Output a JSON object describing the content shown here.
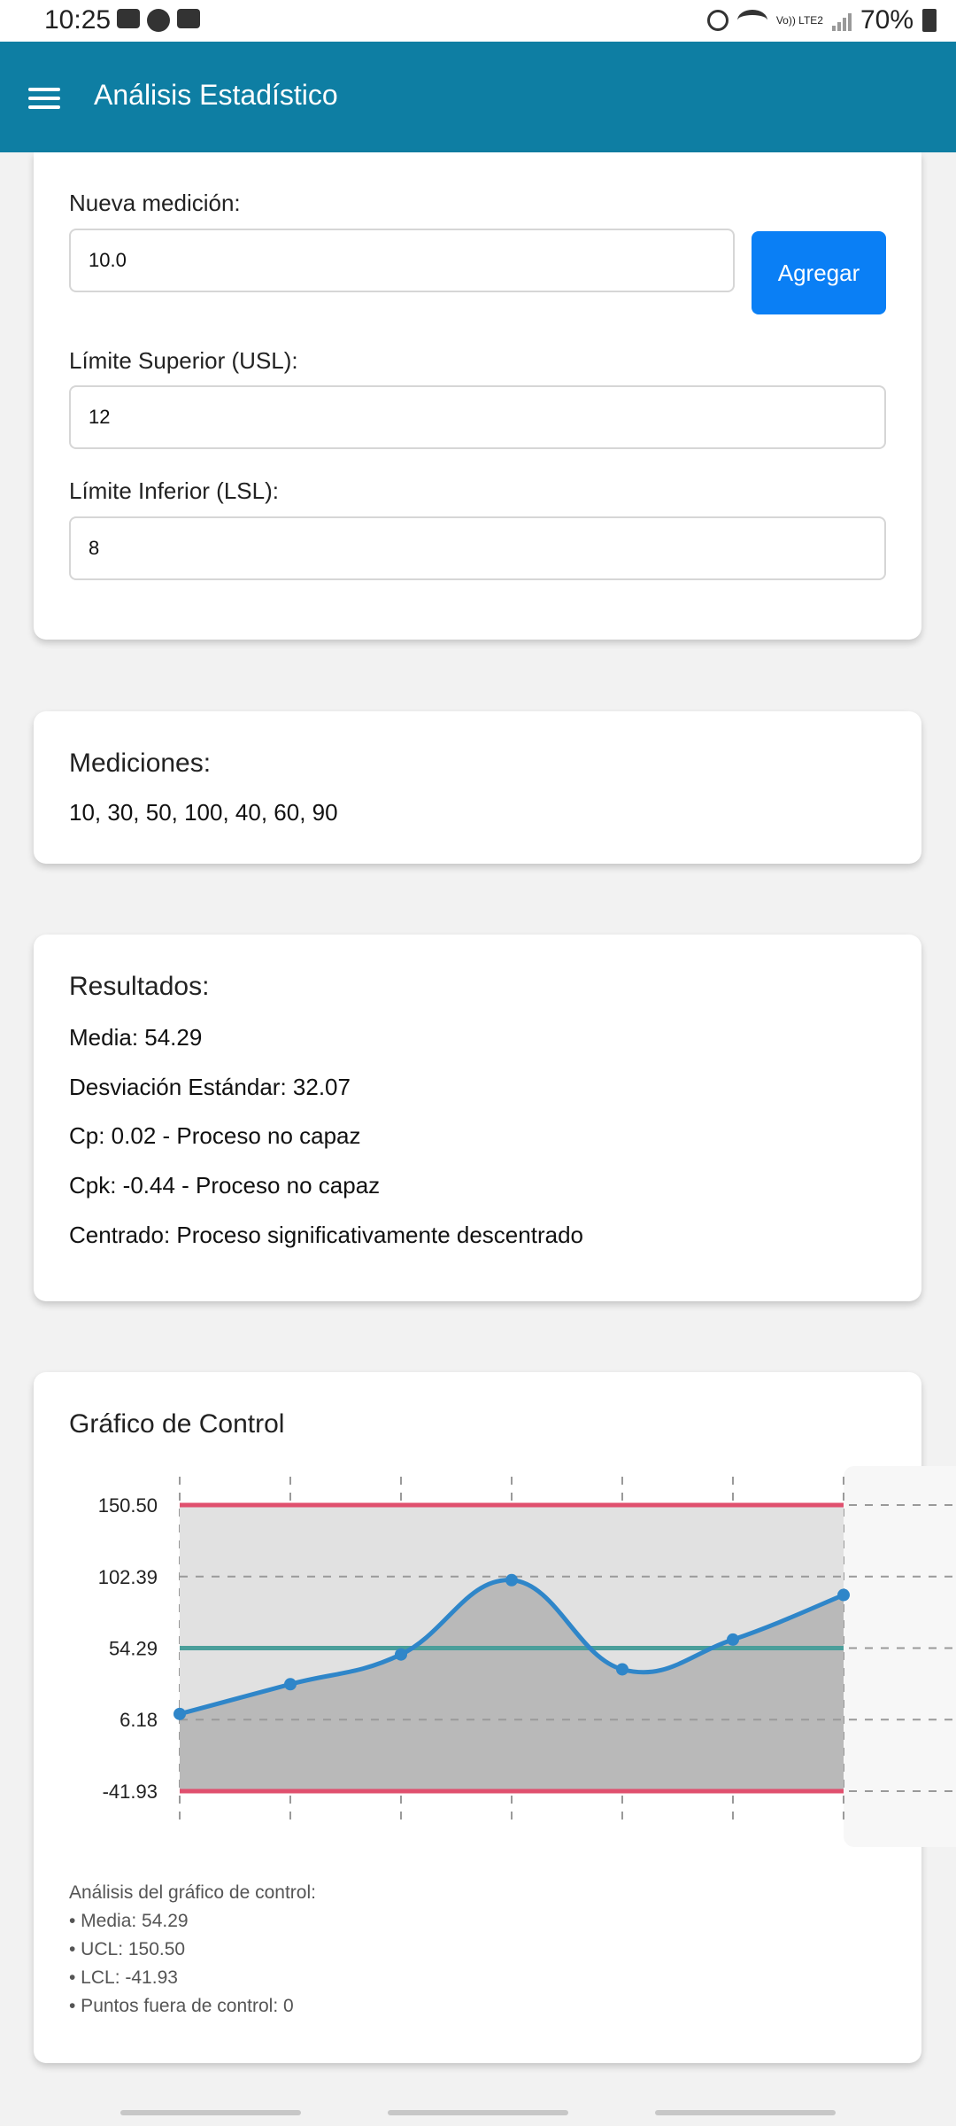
{
  "status_bar": {
    "time": "10:25",
    "network": "Vo)) LTE2",
    "battery": "70%"
  },
  "app_bar": {
    "title": "Análisis Estadístico",
    "menu_icon": "hamburger-menu-icon"
  },
  "inputs_card": {
    "new_measure_label": "Nueva medición:",
    "new_measure_value": "10.0",
    "add_button": "Agregar",
    "usl_label": "Límite Superior (USL):",
    "usl_value": "12",
    "lsl_label": "Límite Inferior (LSL):",
    "lsl_value": "8"
  },
  "measurements_card": {
    "title": "Mediciones:",
    "values": "10, 30, 50, 100, 40, 60, 90"
  },
  "results_card": {
    "title": "Resultados:",
    "mean": "Media: 54.29",
    "std": "Desviación Estándar: 32.07",
    "cp": "Cp: 0.02 - Proceso no capaz",
    "cpk": "Cpk: -0.44 - Proceso no capaz",
    "centering": "Centrado: Proceso significativamente descentrado"
  },
  "chart_card": {
    "title": "Gráfico de Control",
    "analysis_title": "Análisis del gráfico de control:",
    "analysis_mean": "• Media: 54.29",
    "analysis_ucl": "• UCL: 150.50",
    "analysis_lcl": "• LCL: -41.93",
    "analysis_out": "• Puntos fuera de control: 0"
  },
  "colors": {
    "app_bar": "#0e7ea3",
    "button": "#0a7ff5",
    "line": "#2f86c9",
    "limit": "#e0506e",
    "mean": "#4a9e9a"
  },
  "chart_data": {
    "type": "line",
    "x": [
      1,
      2,
      3,
      4,
      5,
      6,
      7
    ],
    "series": [
      {
        "values": [
          10,
          30,
          50,
          100,
          40,
          60,
          90
        ]
      }
    ],
    "ucl": 150.5,
    "mean": 54.29,
    "lcl": -41.93,
    "ytick_labels": [
      "150.50",
      "102.39",
      "54.29",
      "6.18",
      "-41.93"
    ],
    "ytick_values": [
      150.5,
      102.39,
      54.29,
      6.18,
      -41.93
    ],
    "ylim": [
      -41.93,
      150.5
    ],
    "grid": true
  }
}
